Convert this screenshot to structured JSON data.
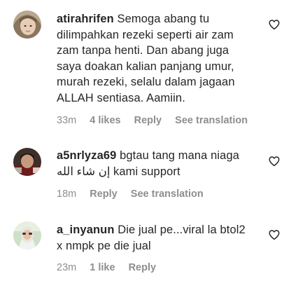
{
  "comments": [
    {
      "username": "atirahrifen",
      "lines": [
        "Semoga abang tu",
        "dilimpahkan rezeki seperti air zam",
        "zam tanpa henti. Dan abang juga",
        "saya doakan kalian panjang umur,",
        "murah rezeki, selalu dalam jagaan",
        "ALLAH sentiasa. Aamiin."
      ],
      "time": "33m",
      "likes": "4 likes",
      "reply": "Reply",
      "translation": "See translation",
      "heart_icon": "heart-outline-icon"
    },
    {
      "username": "a5nrlyza69",
      "lines": [
        "bgtau tang mana niaga",
        "kami support"
      ],
      "arabic": "إن شاء الله",
      "time": "18m",
      "reply": "Reply",
      "translation": "See translation",
      "heart_icon": "heart-outline-icon"
    },
    {
      "username": "a_inyanun",
      "lines": [
        "Die jual pe...viral la btol2",
        "x nmpk pe die jual"
      ],
      "time": "23m",
      "likes": "1 like",
      "reply": "Reply",
      "heart_icon": "heart-outline-icon"
    }
  ],
  "colors": {
    "text": "#262626",
    "meta": "#8e8e8e"
  }
}
